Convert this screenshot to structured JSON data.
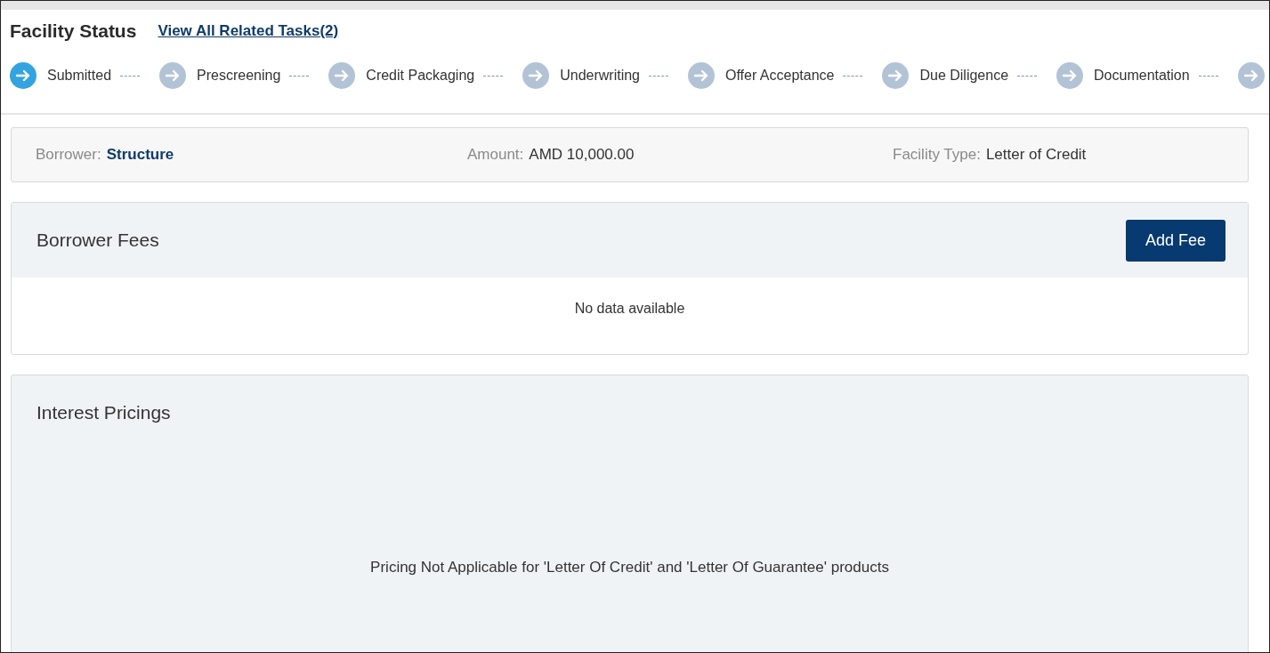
{
  "header": {
    "title": "Facility Status",
    "link": "View All Related Tasks(2)"
  },
  "steps": [
    {
      "label": "Submitted",
      "selected": true
    },
    {
      "label": "Prescreening",
      "selected": false
    },
    {
      "label": "Credit Packaging",
      "selected": false
    },
    {
      "label": "Underwriting",
      "selected": false
    },
    {
      "label": "Offer Acceptance",
      "selected": false
    },
    {
      "label": "Due Diligence",
      "selected": false
    },
    {
      "label": "Documentation",
      "selected": false
    },
    {
      "selected": false
    }
  ],
  "summary": [
    {
      "label": "Borrower:",
      "value": "Structure",
      "kind": "link"
    },
    {
      "label": "Amount:",
      "value": "AMD 10,000.00",
      "kind": "text"
    },
    {
      "label": "Facility Type:",
      "value": "Letter of Credit",
      "kind": "text"
    }
  ],
  "borrower_fees": {
    "title": "Borrower Fees",
    "button": "Add Fee",
    "empty": "No data available"
  },
  "interest_pricings": {
    "title": "Interest Pricings",
    "message": "Pricing Not Applicable for 'Letter Of Credit' and 'Letter Of Guarantee' products"
  }
}
